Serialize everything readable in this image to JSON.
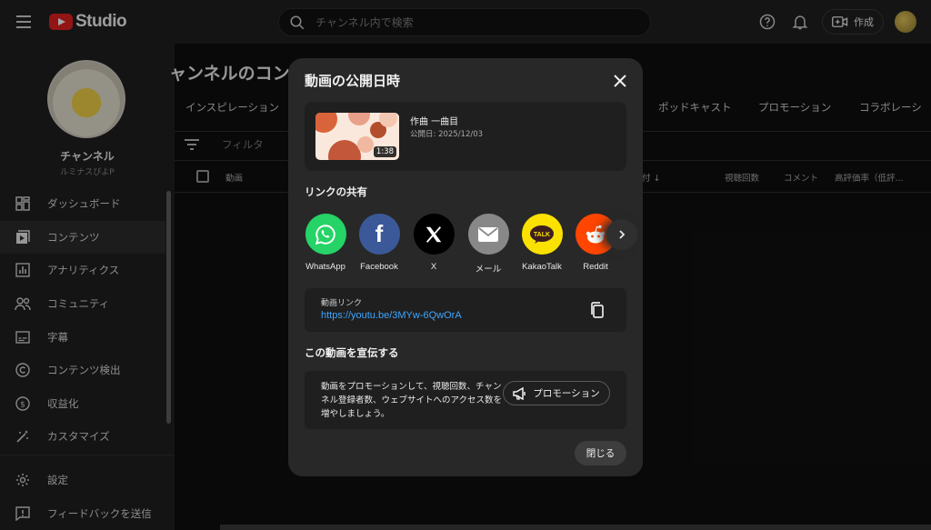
{
  "topbar": {
    "logo_text": "Studio",
    "search_placeholder": "チャンネル内で検索",
    "create_label": "作成"
  },
  "sidebar": {
    "channel_name": "チャンネル",
    "channel_handle": "ルミナスぴよP",
    "items": [
      {
        "label": "ダッシュボード",
        "icon": "dashboard-icon"
      },
      {
        "label": "コンテンツ",
        "icon": "content-icon",
        "active": true
      },
      {
        "label": "アナリティクス",
        "icon": "analytics-icon"
      },
      {
        "label": "コミュニティ",
        "icon": "community-icon"
      },
      {
        "label": "字幕",
        "icon": "subtitles-icon"
      },
      {
        "label": "コンテンツ検出",
        "icon": "copyright-icon"
      },
      {
        "label": "収益化",
        "icon": "monetization-icon"
      },
      {
        "label": "カスタマイズ",
        "icon": "customize-icon"
      }
    ],
    "bottom_items": [
      {
        "label": "設定",
        "icon": "settings-icon"
      },
      {
        "label": "フィードバックを送信",
        "icon": "feedback-icon"
      }
    ]
  },
  "main": {
    "title": "ャンネルのコン",
    "tabs": [
      "インスピレーション",
      "ポッドキャスト",
      "プロモーション",
      "コラボレーシ"
    ],
    "filter_placeholder": "フィルタ",
    "columns": {
      "video": "動画",
      "date": "付",
      "views": "視聴回数",
      "comments": "コメント",
      "likes": "高評価率（低評..."
    }
  },
  "dialog": {
    "title": "動画の公開日時",
    "video": {
      "title": "作曲 一曲目",
      "date": "公開日: 2025/12/03",
      "duration": "1:38"
    },
    "share_section_label": "リンクの共有",
    "share_targets": [
      {
        "label": "WhatsApp",
        "color": "#25d366"
      },
      {
        "label": "Facebook",
        "color": "#3b5998"
      },
      {
        "label": "X",
        "color": "#000000"
      },
      {
        "label": "メール",
        "color": "#888888"
      },
      {
        "label": "KakaoTalk",
        "color": "#fae100"
      },
      {
        "label": "Reddit",
        "color": "#ff4500"
      }
    ],
    "link": {
      "label": "動画リンク",
      "url": "https://youtu.be/3MYw-6QwOrA"
    },
    "promo_section_label": "この動画を宣伝する",
    "promo": {
      "text": "動画をプロモーションして、視聴回数、チャンネル登録者数、ウェブサイトへのアクセス数を増やしましょう。",
      "button_label": "プロモーション"
    },
    "close_label": "閉じる"
  }
}
